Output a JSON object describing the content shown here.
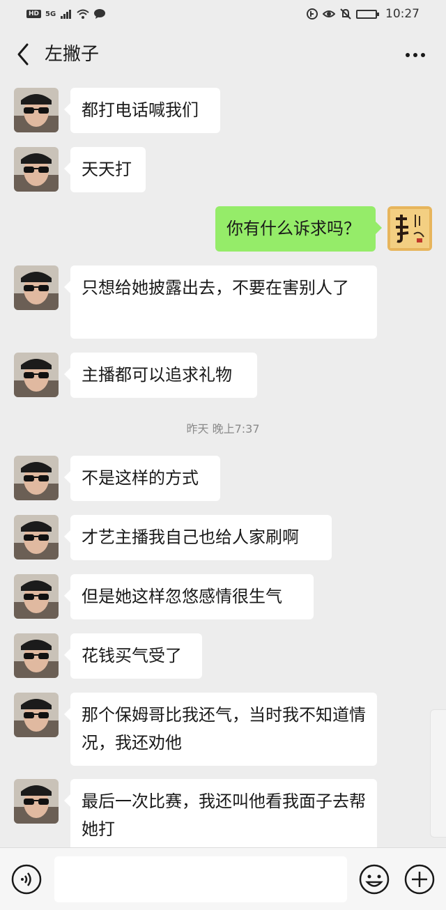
{
  "status_bar": {
    "hd": "HD",
    "network": "5G",
    "time": "10:27"
  },
  "header": {
    "title": "左撇子"
  },
  "messages": [
    {
      "side": "left",
      "text": "都打电话喊我们"
    },
    {
      "side": "left",
      "text": "天天打"
    },
    {
      "side": "right",
      "text": "你有什么诉求吗？"
    },
    {
      "side": "left",
      "text": "只想给她披露出去，不要在害别人了"
    },
    {
      "side": "left",
      "text": "主播都可以追求礼物"
    },
    {
      "side": "left",
      "text": "不是这样的方式"
    },
    {
      "side": "left",
      "text": "才艺主播我自己也给人家刷啊"
    },
    {
      "side": "left",
      "text": "但是她这样忽悠感情很生气"
    },
    {
      "side": "left",
      "text": "花钱买气受了"
    },
    {
      "side": "left",
      "text": "那个保姆哥比我还气，当时我不知道情况，我还劝他"
    },
    {
      "side": "left",
      "text": "最后一次比赛，我还叫他看我面子去帮她打"
    }
  ],
  "timestamp": "昨天 晚上7:37",
  "input": {
    "value": ""
  },
  "colors": {
    "background": "#ededed",
    "bubble_left": "#ffffff",
    "bubble_right": "#95ec69",
    "input_bar": "#f6f6f6"
  },
  "icons": {
    "back": "chevron-left-icon",
    "more": "more-dots-icon",
    "voice": "voice-icon",
    "emoji": "emoji-icon",
    "plus": "plus-icon"
  }
}
